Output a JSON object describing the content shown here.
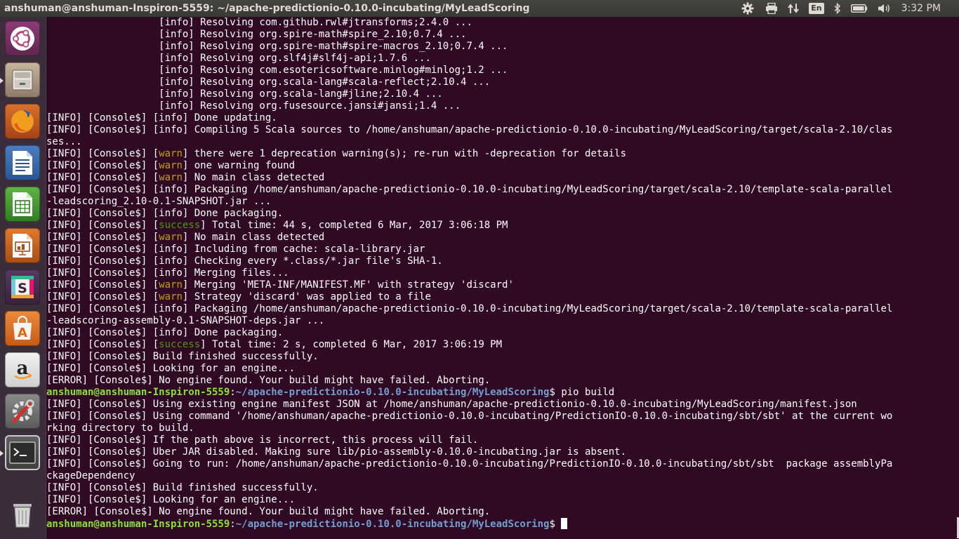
{
  "topbar": {
    "window_title": "anshuman@anshuman-Inspiron-5559: ~/apache-predictionio-0.10.0-incubating/MyLeadScoring",
    "lang": "En",
    "clock": "3:32 PM",
    "icons": [
      "gear-icon",
      "printer-icon",
      "network-icon",
      "keyboard-layout-icon",
      "bluetooth-icon",
      "battery-icon",
      "volume-icon"
    ]
  },
  "launcher": {
    "items": [
      "ubuntu-dash",
      "files",
      "firefox",
      "libreoffice-writer",
      "libreoffice-calc",
      "libreoffice-impress",
      "slack",
      "ubuntu-software",
      "amazon",
      "system-settings",
      "terminal",
      "trash"
    ]
  },
  "terminal": {
    "lines": [
      {
        "parts": [
          {
            "t": "                   [info] Resolving com.github.rwl#jtransforms;2.4.0 ...",
            "c": ""
          }
        ]
      },
      {
        "parts": [
          {
            "t": "                   [info] Resolving org.spire-math#spire_2.10;0.7.4 ...",
            "c": ""
          }
        ]
      },
      {
        "parts": [
          {
            "t": "                   [info] Resolving org.spire-math#spire-macros_2.10;0.7.4 ...",
            "c": ""
          }
        ]
      },
      {
        "parts": [
          {
            "t": "                   [info] Resolving org.slf4j#slf4j-api;1.7.6 ...",
            "c": ""
          }
        ]
      },
      {
        "parts": [
          {
            "t": "                   [info] Resolving com.esotericsoftware.minlog#minlog;1.2 ...",
            "c": ""
          }
        ]
      },
      {
        "parts": [
          {
            "t": "                   [info] Resolving org.scala-lang#scala-reflect;2.10.4 ...",
            "c": ""
          }
        ]
      },
      {
        "parts": [
          {
            "t": "                   [info] Resolving org.scala-lang#jline;2.10.4 ...",
            "c": ""
          }
        ]
      },
      {
        "parts": [
          {
            "t": "                   [info] Resolving org.fusesource.jansi#jansi;1.4 ...",
            "c": ""
          }
        ]
      },
      {
        "parts": [
          {
            "t": "[INFO] [Console$] [info] Done updating.",
            "c": ""
          }
        ]
      },
      {
        "parts": [
          {
            "t": "[INFO] [Console$] [info] Compiling 5 Scala sources to /home/anshuman/apache-predictionio-0.10.0-incubating/MyLeadScoring/target/scala-2.10/clas",
            "c": ""
          }
        ]
      },
      {
        "parts": [
          {
            "t": "ses...",
            "c": ""
          }
        ]
      },
      {
        "parts": [
          {
            "t": "[INFO] [Console$] [",
            "c": ""
          },
          {
            "t": "warn",
            "c": "warn"
          },
          {
            "t": "] there were 1 deprecation warning(s); re-run with -deprecation for details",
            "c": ""
          }
        ]
      },
      {
        "parts": [
          {
            "t": "[INFO] [Console$] [",
            "c": ""
          },
          {
            "t": "warn",
            "c": "warn"
          },
          {
            "t": "] one warning found",
            "c": ""
          }
        ]
      },
      {
        "parts": [
          {
            "t": "[INFO] [Console$] [",
            "c": ""
          },
          {
            "t": "warn",
            "c": "warn"
          },
          {
            "t": "] No main class detected",
            "c": ""
          }
        ]
      },
      {
        "parts": [
          {
            "t": "[INFO] [Console$] [info] Packaging /home/anshuman/apache-predictionio-0.10.0-incubating/MyLeadScoring/target/scala-2.10/template-scala-parallel",
            "c": ""
          }
        ]
      },
      {
        "parts": [
          {
            "t": "-leadscoring_2.10-0.1-SNAPSHOT.jar ...",
            "c": ""
          }
        ]
      },
      {
        "parts": [
          {
            "t": "[INFO] [Console$] [info] Done packaging.",
            "c": ""
          }
        ]
      },
      {
        "parts": [
          {
            "t": "[INFO] [Console$] [",
            "c": ""
          },
          {
            "t": "success",
            "c": "success"
          },
          {
            "t": "] Total time: 44 s, completed 6 Mar, 2017 3:06:18 PM",
            "c": ""
          }
        ]
      },
      {
        "parts": [
          {
            "t": "[INFO] [Console$] [",
            "c": ""
          },
          {
            "t": "warn",
            "c": "warn"
          },
          {
            "t": "] No main class detected",
            "c": ""
          }
        ]
      },
      {
        "parts": [
          {
            "t": "[INFO] [Console$] [info] Including from cache: scala-library.jar",
            "c": ""
          }
        ]
      },
      {
        "parts": [
          {
            "t": "[INFO] [Console$] [info] Checking every *.class/*.jar file's SHA-1.",
            "c": ""
          }
        ]
      },
      {
        "parts": [
          {
            "t": "[INFO] [Console$] [info] Merging files...",
            "c": ""
          }
        ]
      },
      {
        "parts": [
          {
            "t": "[INFO] [Console$] [",
            "c": ""
          },
          {
            "t": "warn",
            "c": "warn"
          },
          {
            "t": "] Merging 'META-INF/MANIFEST.MF' with strategy 'discard'",
            "c": ""
          }
        ]
      },
      {
        "parts": [
          {
            "t": "[INFO] [Console$] [",
            "c": ""
          },
          {
            "t": "warn",
            "c": "warn"
          },
          {
            "t": "] Strategy 'discard' was applied to a file",
            "c": ""
          }
        ]
      },
      {
        "parts": [
          {
            "t": "[INFO] [Console$] [info] Packaging /home/anshuman/apache-predictionio-0.10.0-incubating/MyLeadScoring/target/scala-2.10/template-scala-parallel",
            "c": ""
          }
        ]
      },
      {
        "parts": [
          {
            "t": "-leadscoring-assembly-0.1-SNAPSHOT-deps.jar ...",
            "c": ""
          }
        ]
      },
      {
        "parts": [
          {
            "t": "[INFO] [Console$] [info] Done packaging.",
            "c": ""
          }
        ]
      },
      {
        "parts": [
          {
            "t": "[INFO] [Console$] [",
            "c": ""
          },
          {
            "t": "success",
            "c": "success"
          },
          {
            "t": "] Total time: 2 s, completed 6 Mar, 2017 3:06:19 PM",
            "c": ""
          }
        ]
      },
      {
        "parts": [
          {
            "t": "[INFO] [Console$] Build finished successfully.",
            "c": ""
          }
        ]
      },
      {
        "parts": [
          {
            "t": "[INFO] [Console$] Looking for an engine...",
            "c": ""
          }
        ]
      },
      {
        "parts": [
          {
            "t": "[ERROR] [Console$] No engine found. Your build might have failed. Aborting.",
            "c": ""
          }
        ]
      },
      {
        "parts": [
          {
            "t": "anshuman@anshuman-Inspiron-5559",
            "c": "puser"
          },
          {
            "t": ":",
            "c": ""
          },
          {
            "t": "~/apache-predictionio-0.10.0-incubating/MyLeadScoring",
            "c": "ppath"
          },
          {
            "t": "$ pio build",
            "c": ""
          }
        ]
      },
      {
        "parts": [
          {
            "t": "[INFO] [Console$] Using existing engine manifest JSON at /home/anshuman/apache-predictionio-0.10.0-incubating/MyLeadScoring/manifest.json",
            "c": ""
          }
        ]
      },
      {
        "parts": [
          {
            "t": "[INFO] [Console$] Using command '/home/anshuman/apache-predictionio-0.10.0-incubating/PredictionIO-0.10.0-incubating/sbt/sbt' at the current wo",
            "c": ""
          }
        ]
      },
      {
        "parts": [
          {
            "t": "rking directory to build.",
            "c": ""
          }
        ]
      },
      {
        "parts": [
          {
            "t": "[INFO] [Console$] If the path above is incorrect, this process will fail.",
            "c": ""
          }
        ]
      },
      {
        "parts": [
          {
            "t": "[INFO] [Console$] Uber JAR disabled. Making sure lib/pio-assembly-0.10.0-incubating.jar is absent.",
            "c": ""
          }
        ]
      },
      {
        "parts": [
          {
            "t": "[INFO] [Console$] Going to run: /home/anshuman/apache-predictionio-0.10.0-incubating/PredictionIO-0.10.0-incubating/sbt/sbt  package assemblyPa",
            "c": ""
          }
        ]
      },
      {
        "parts": [
          {
            "t": "ckageDependency",
            "c": ""
          }
        ]
      },
      {
        "parts": [
          {
            "t": "[INFO] [Console$] Build finished successfully.",
            "c": ""
          }
        ]
      },
      {
        "parts": [
          {
            "t": "[INFO] [Console$] Looking for an engine...",
            "c": ""
          }
        ]
      },
      {
        "parts": [
          {
            "t": "[ERROR] [Console$] No engine found. Your build might have failed. Aborting.",
            "c": ""
          }
        ]
      },
      {
        "parts": [
          {
            "t": "anshuman@anshuman-Inspiron-5559",
            "c": "puser"
          },
          {
            "t": ":",
            "c": ""
          },
          {
            "t": "~/apache-predictionio-0.10.0-incubating/MyLeadScoring",
            "c": "ppath"
          },
          {
            "t": "$ ",
            "c": ""
          }
        ],
        "cursor": true
      }
    ]
  }
}
